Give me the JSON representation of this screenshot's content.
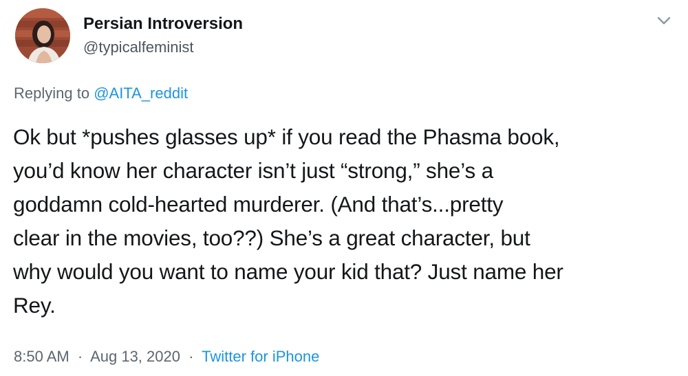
{
  "author": {
    "display_name": "Persian Introversion",
    "handle": "@typicalfeminist"
  },
  "reply": {
    "prefix": "Replying to",
    "mention": "@AITA_reddit"
  },
  "tweet": {
    "lines": [
      "Ok but *pushes glasses up* if you read the Phasma book,",
      "you’d know her character isn’t just “strong,” she’s a",
      "goddamn cold-hearted murderer. (And that’s...pretty",
      "clear in the movies, too??) She’s a great character, but",
      "why would you want to name your kid that? Just name her",
      "Rey."
    ]
  },
  "meta": {
    "time": "8:50 AM",
    "separator": "·",
    "date": "Aug 13, 2020",
    "source": "Twitter for iPhone"
  },
  "icons": {
    "menu": "chevron-down-icon",
    "avatar": "avatar"
  },
  "colors": {
    "link": "#1b95e0",
    "secondary_text": "#5b6670",
    "primary_text": "#14171a"
  }
}
